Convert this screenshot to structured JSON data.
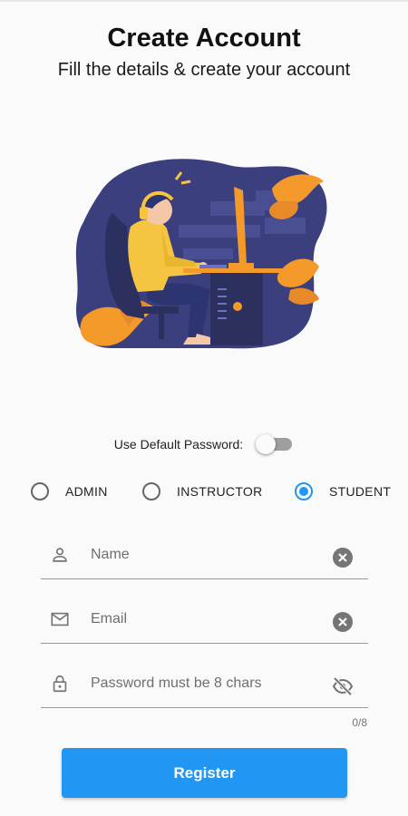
{
  "header": {
    "title": "Create Account",
    "subtitle": "Fill the details & create your account"
  },
  "illustration": {
    "icon": "person-at-computer-illustration"
  },
  "default_password": {
    "label": "Use Default Password:",
    "enabled": false
  },
  "roles": {
    "options": [
      "ADMIN",
      "INSTRUCTOR",
      "STUDENT"
    ],
    "selected": "STUDENT"
  },
  "fields": {
    "name": {
      "value": "",
      "placeholder": "Name",
      "icon": "person-icon",
      "trailing_icon": "clear-icon"
    },
    "email": {
      "value": "",
      "placeholder": "Email",
      "icon": "mail-icon",
      "trailing_icon": "clear-icon"
    },
    "password": {
      "value": "",
      "placeholder": "Password must be 8 chars",
      "icon": "lock-icon",
      "trailing_icon": "visibility-off-icon",
      "counter": "0/8"
    }
  },
  "actions": {
    "register_label": "Register"
  },
  "colors": {
    "accent": "#2196f3",
    "illustration_bg": "#3b3f7e",
    "illustration_orange": "#f39a2b",
    "shirt_yellow": "#f5c542"
  }
}
